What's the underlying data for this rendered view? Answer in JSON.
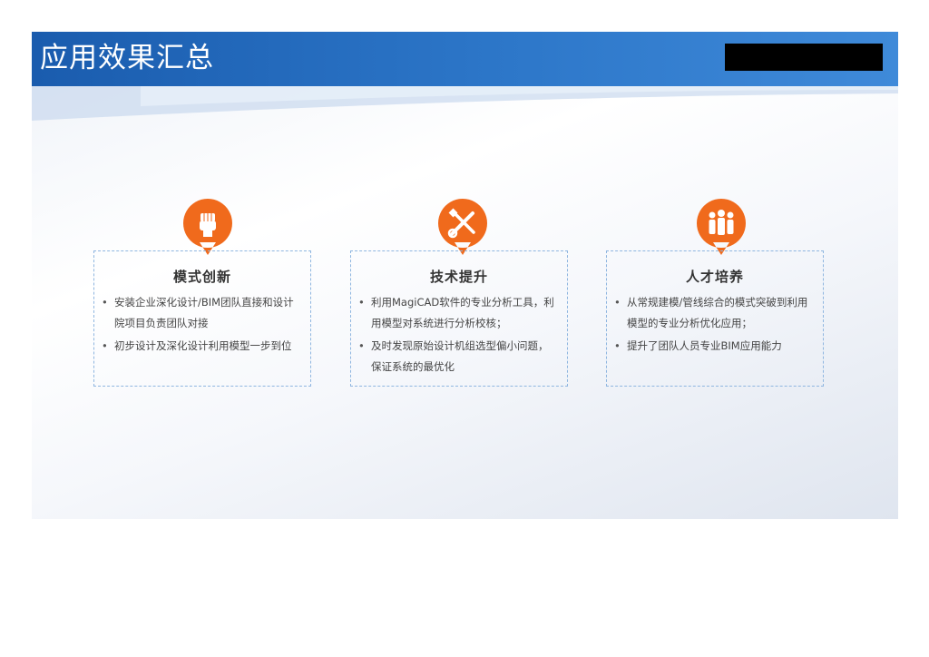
{
  "slide": {
    "title": "应用效果汇总"
  },
  "colors": {
    "header": "#1a5cae",
    "pin": "#f06a1c",
    "border": "#8fb6e0"
  },
  "cards": [
    {
      "icon": "fist-icon",
      "title": "模式创新",
      "items": [
        "安装企业深化设计/BIM团队直接和设计院项目负责团队对接",
        "初步设计及深化设计利用模型一步到位"
      ]
    },
    {
      "icon": "wrench-screwdriver-icon",
      "title": "技术提升",
      "items": [
        "利用MagiCAD软件的专业分析工具，利用模型对系统进行分析校核；",
        "及时发现原始设计机组选型偏小问题，保证系统的最优化"
      ]
    },
    {
      "icon": "team-icon",
      "title": "人才培养",
      "items": [
        "从常规建模/管线综合的模式突破到利用模型的专业分析优化应用；",
        "提升了团队人员专业BIM应用能力"
      ]
    }
  ],
  "bullet": "•"
}
